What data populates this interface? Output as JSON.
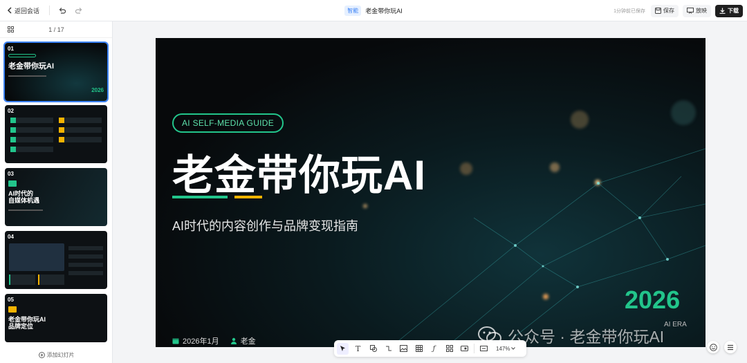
{
  "header": {
    "back_label": "返回会话",
    "badge": "智能",
    "title": "老金带你玩AI",
    "saved_status": "1分钟前已保存",
    "save_label": "保存",
    "present_label": "放映",
    "download_label": "下载"
  },
  "sidebar": {
    "page_count": "1 / 17",
    "add_slide_label": "添加幻灯片",
    "thumbs": [
      {
        "num": "01",
        "title": "老金带你玩AI",
        "year": "2026"
      },
      {
        "num": "02"
      },
      {
        "num": "03",
        "title": "AI时代的\n自媒体机遇"
      },
      {
        "num": "04"
      },
      {
        "num": "05",
        "title": "老金带你玩AI\n品牌定位"
      }
    ]
  },
  "slide": {
    "pill": "AI SELF-MEDIA GUIDE",
    "title": "老金带你玩AI",
    "subtitle": "AI时代的内容创作与品牌变现指南",
    "year": "2026",
    "year_caption": "AI ERA",
    "date": "2026年1月",
    "author": "老金"
  },
  "watermark": "公众号 · 老金带你玩AI",
  "toolbar": {
    "zoom": "147%"
  },
  "colors": {
    "accent_green": "#22c58b",
    "accent_yellow": "#f5b301",
    "primary_blue": "#3b82f6"
  }
}
